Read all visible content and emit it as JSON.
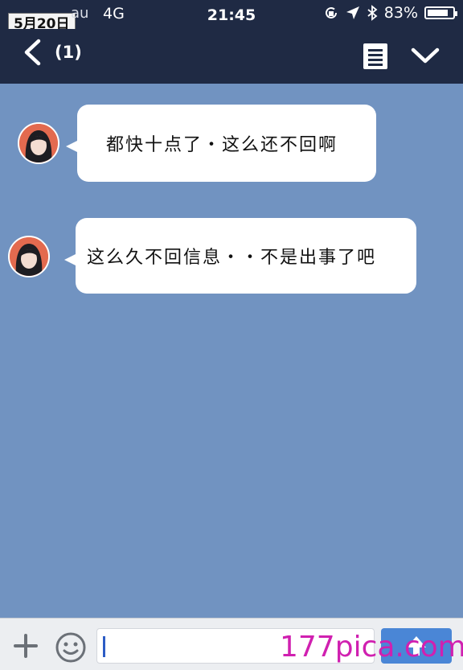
{
  "status_bar": {
    "date_tag": "5月20日",
    "carrier": "au",
    "network": "4G",
    "time": "21:45",
    "battery_percent": "83%",
    "battery_level": 0.83,
    "icons": [
      "rotation-lock-icon",
      "location-arrow-icon",
      "bluetooth-icon",
      "battery-icon"
    ]
  },
  "nav_bar": {
    "back_count": "(1)",
    "icons": [
      "back-chevron-icon",
      "menu-list-icon",
      "chevron-down-icon"
    ]
  },
  "messages": [
    {
      "sender": "contact",
      "text": "都快十点了・这么还不回啊"
    },
    {
      "sender": "contact",
      "text": "这么久不回信息・・不是出事了吧"
    }
  ],
  "input_bar": {
    "placeholder": "",
    "icons": [
      "plus-icon",
      "emoji-icon",
      "send-icon"
    ]
  },
  "watermark": "177pica.com",
  "colors": {
    "header": "#1f2a44",
    "chat_background": "#7193c1",
    "bubble": "#ffffff",
    "avatar_ring": "#e36a4f",
    "send_button": "#4a86d6",
    "watermark": "#d020b0"
  }
}
